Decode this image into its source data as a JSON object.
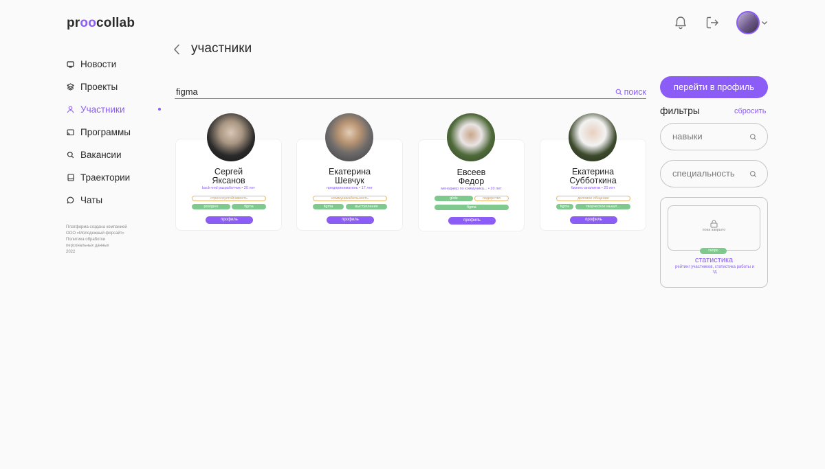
{
  "app": {
    "logo_pre": "pr",
    "logo_oo": "oo",
    "logo_post": "collab"
  },
  "header": {
    "icons": [
      "bell-icon",
      "logout-icon",
      "avatar",
      "chevron-down-icon"
    ]
  },
  "sidebar": {
    "items": [
      {
        "label": "Новости",
        "icon": "news-icon"
      },
      {
        "label": "Проекты",
        "icon": "projects-icon"
      },
      {
        "label": "Участники",
        "icon": "user-icon",
        "active": true
      },
      {
        "label": "Программы",
        "icon": "programs-icon"
      },
      {
        "label": "Вакансии",
        "icon": "search-icon"
      },
      {
        "label": "Траектории",
        "icon": "book-icon"
      },
      {
        "label": "Чаты",
        "icon": "chat-icon"
      }
    ],
    "footer": [
      "Платформа создана компанией",
      "ООО «Молодежный форсайт»",
      "Политика обработки",
      "персональных данных",
      "2022"
    ]
  },
  "page": {
    "title": "участники"
  },
  "search": {
    "value": "figma",
    "button_label": "поиск"
  },
  "cards": [
    {
      "name_line1": "Сергей",
      "name_line2": "Яксанов",
      "role": "back-end разработчик • 20 лет",
      "tags": [
        "стрессоустойчивость",
        "postgres",
        "figma"
      ],
      "button": "профиль"
    },
    {
      "name_line1": "Екатерина",
      "name_line2": "Шевчук",
      "role": "предприниматель • 17 лет",
      "tags": [
        "коммуникабельность",
        "figma",
        "выступления"
      ],
      "button": "профиль"
    },
    {
      "name_line1": "Евсеев",
      "name_line2": "Федор",
      "role": "менеджер по коммуника... • 20 лет",
      "tags": [
        "glide",
        "лидерство",
        "figma"
      ],
      "button": "профиль"
    },
    {
      "name_line1": "Екатерина",
      "name_line2": "Субботкина",
      "role": "бизнес-аналитик • 20 лет",
      "tags": [
        "деловое общение",
        "figma",
        "творческое мышл..."
      ],
      "button": "профиль"
    }
  ],
  "right_panel": {
    "goto_button": "перейти в профиль",
    "filters_title": "фильтры",
    "reset_label": "сбросить",
    "skills_placeholder": "навыки",
    "specialty_placeholder": "специальность",
    "stats": {
      "closed_text": "пока закрыто",
      "soon_badge": "скоро",
      "title": "статистика",
      "description": "рейтинг участников, статистика работы и тд"
    }
  },
  "colors": {
    "accent": "#8b5cf6",
    "tag_green": "#7fc98f",
    "tag_orange": "#e8b56a"
  }
}
